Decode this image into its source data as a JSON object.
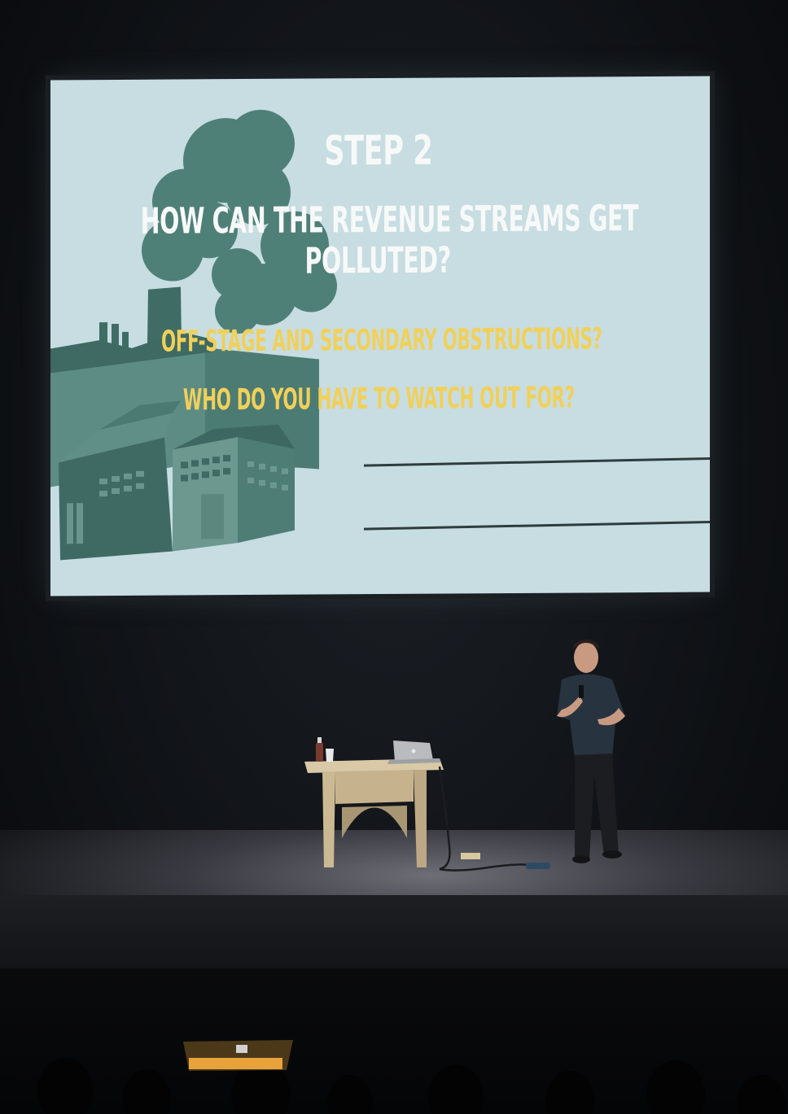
{
  "slide": {
    "title": "STEP 2",
    "question_line1": "HOW CAN THE REVENUE STREAMS GET",
    "question_line2": "POLLUTED?",
    "points": [
      "OFF-STAGE AND SECONDARY OBSTRUCTIONS?",
      "WHO DO YOU HAVE TO WATCH OUT FOR?"
    ],
    "colors": {
      "background": "#c7dde2",
      "title": "#f7f9f8",
      "points": "#f1d05a",
      "illustration": "#4f8078"
    }
  },
  "scene": {
    "objects": [
      "projection-screen",
      "presenter",
      "lectern",
      "laptop",
      "water-bottle",
      "cup",
      "cables",
      "audience-heads"
    ]
  }
}
